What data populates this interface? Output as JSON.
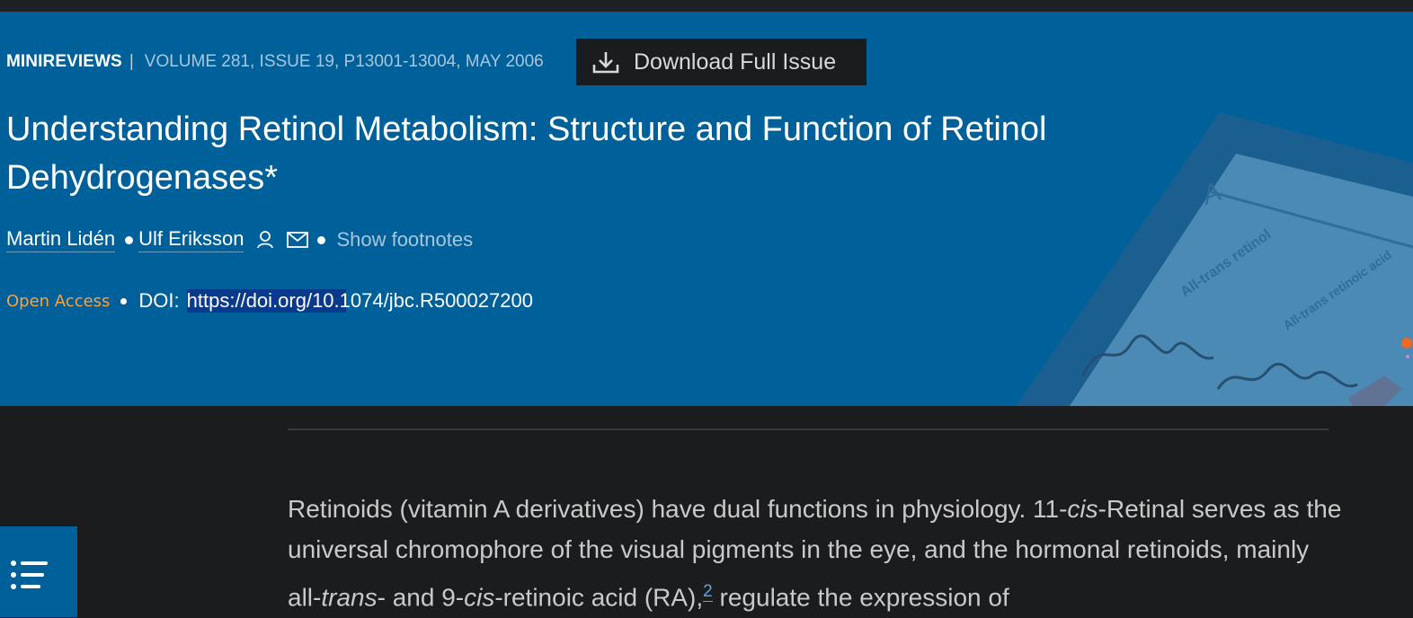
{
  "article": {
    "type": "MINIREVIEWS",
    "separator": "|",
    "volume_info": "VOLUME 281, ISSUE 19, P13001-13004, MAY 2006",
    "download_label": "Download Full Issue",
    "title": "Understanding Retinol Metabolism: Structure and Function of Retinol Dehydrogenases*",
    "authors": [
      "Martin Lidén",
      "Ulf Eriksson"
    ],
    "show_footnotes": "Show footnotes",
    "open_access": "Open Access",
    "doi_label": "DOI:",
    "doi_url": "https://doi.org/10.1074/jbc.R500027200"
  },
  "body": {
    "s1": "Retinoids (vitamin A derivatives) have dual functions in physiology. 11-",
    "s2": "cis",
    "s3": "-Retinal serves as the universal chromophore of the visual pigments in the eye, and the hormonal retinoids, mainly all-",
    "s4": "trans",
    "s5": "- and 9-",
    "s6": "cis",
    "s7": "-retinoic acid (RA),",
    "footnote_ref": "2",
    "s8": " regulate the expression of"
  },
  "cover_image": {
    "panel_label": "A",
    "lane_label_1": "All-trans retinol",
    "lane_label_2": "All-trans retinoic acid"
  },
  "colors": {
    "hero_bg": "#00609a",
    "page_bg": "#1b1c1e",
    "open_access": "#f7a144",
    "link": "#5fa6e0"
  },
  "icons": [
    "download-icon",
    "person-icon",
    "mail-icon",
    "list-icon"
  ]
}
